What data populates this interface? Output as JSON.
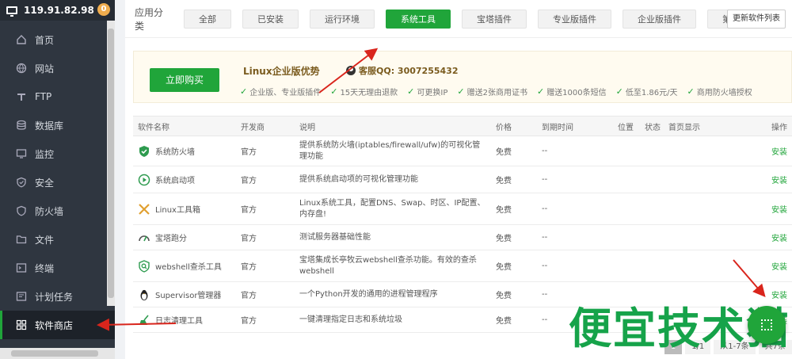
{
  "sidebar": {
    "ip": "119.91.82.98",
    "badge": "0",
    "items": [
      {
        "label": "首页",
        "icon": "home-icon"
      },
      {
        "label": "网站",
        "icon": "globe-icon"
      },
      {
        "label": "FTP",
        "icon": "ftp-icon"
      },
      {
        "label": "数据库",
        "icon": "database-icon"
      },
      {
        "label": "监控",
        "icon": "monitor-icon"
      },
      {
        "label": "安全",
        "icon": "shield-icon"
      },
      {
        "label": "防火墙",
        "icon": "firewall-icon"
      },
      {
        "label": "文件",
        "icon": "folder-icon"
      },
      {
        "label": "终端",
        "icon": "terminal-icon"
      },
      {
        "label": "计划任务",
        "icon": "clock-icon"
      },
      {
        "label": "软件商店",
        "icon": "grid-icon"
      }
    ]
  },
  "categories": {
    "label": "应用分类",
    "buttons": [
      "全部",
      "已安装",
      "运行环境",
      "系统工具",
      "宝塔插件",
      "专业版插件",
      "企业版插件",
      "第三方应用"
    ],
    "selected_index": 3,
    "refresh_label": "更新软件列表"
  },
  "promo": {
    "buy_label": "立即购买",
    "title": "Linux企业版优势",
    "qq": "客服QQ: 3007255432",
    "features": [
      "企业版、专业版插件",
      "15天无理由退款",
      "可更换IP",
      "赠送2张商用证书",
      "赠送1000条短信",
      "低至1.86元/天",
      "商用防火墙授权"
    ]
  },
  "table": {
    "headers": [
      "软件名称",
      "开发商",
      "说明",
      "价格",
      "到期时间",
      "位置",
      "状态",
      "首页显示",
      "操作"
    ],
    "rows": [
      {
        "name": "系统防火墙",
        "dev": "官方",
        "desc": "提供系统防火墙(iptables/firewall/ufw)的可视化管理功能",
        "price": "免费",
        "expire": "--",
        "op": "安装",
        "icon": "firewall-shield-icon"
      },
      {
        "name": "系统启动项",
        "dev": "官方",
        "desc": "提供系统启动项的可视化管理功能",
        "price": "免费",
        "expire": "--",
        "op": "安装",
        "icon": "play-circle-icon"
      },
      {
        "name": "Linux工具箱",
        "dev": "官方",
        "desc": "Linux系统工具，配置DNS、Swap、时区、IP配置、内存盘!",
        "price": "免费",
        "expire": "--",
        "op": "安装",
        "icon": "tools-icon"
      },
      {
        "name": "宝塔跑分",
        "dev": "官方",
        "desc": "测试服务器基础性能",
        "price": "免费",
        "expire": "--",
        "op": "安装",
        "icon": "gauge-icon"
      },
      {
        "name": "webshell查杀工具",
        "dev": "官方",
        "desc": "宝塔集成长亭牧云webshell查杀功能。有效的查杀webshell",
        "price": "免费",
        "expire": "--",
        "op": "安装",
        "icon": "shield-search-icon"
      },
      {
        "name": "Supervisor管理器",
        "dev": "官方",
        "desc": "一个Python开发的通用的进程管理程序",
        "price": "免费",
        "expire": "--",
        "op": "安装",
        "icon": "penguin-icon"
      },
      {
        "name": "日志清理工具",
        "dev": "官方",
        "desc": "一键清理指定日志和系统垃圾",
        "price": "免费",
        "expire": "--",
        "op": "安装",
        "icon": "broom-icon"
      }
    ]
  },
  "pager": {
    "current": "1",
    "pages": "1/1",
    "range": "从1-7条",
    "total": "共7条"
  },
  "watermark": "便宜技术猫",
  "colors": {
    "accent": "#20a53a",
    "sidebar_bg": "#2f3640",
    "arrow": "#d9251c"
  }
}
